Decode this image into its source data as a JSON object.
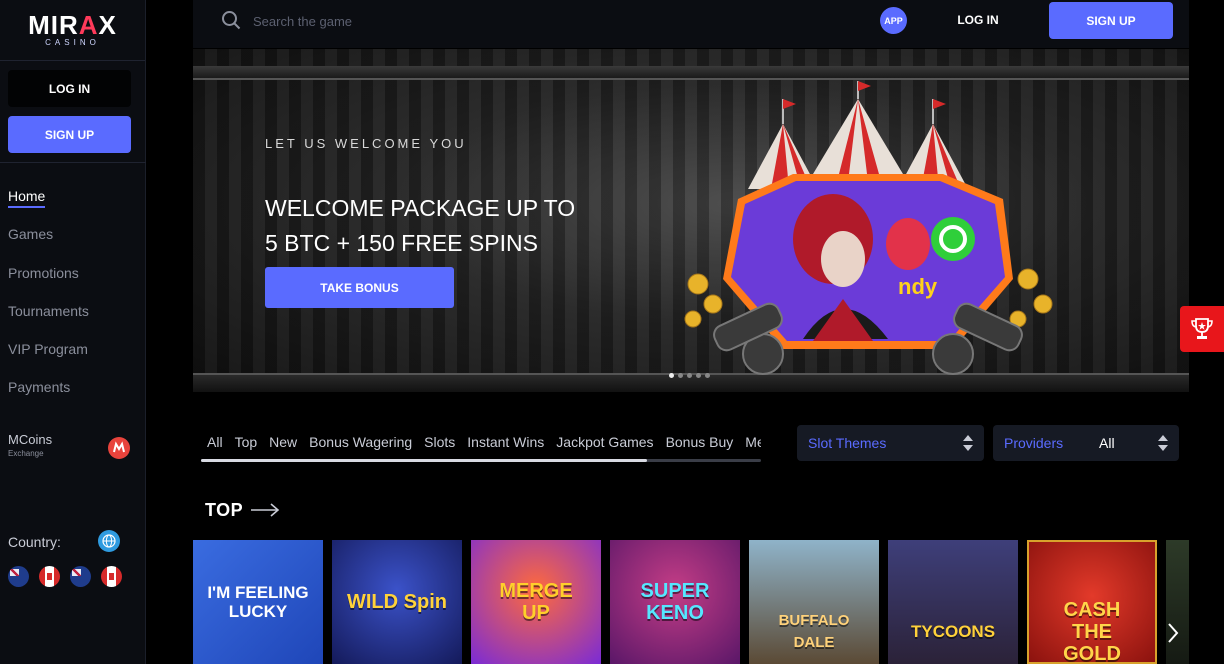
{
  "sidebar": {
    "logo": {
      "brand_a": "MIR",
      "brand_b": "A",
      "brand_c": "X",
      "sub": "CASINO"
    },
    "login_label": "LOG IN",
    "signup_label": "SIGN UP",
    "nav": [
      {
        "label": "Home",
        "active": true
      },
      {
        "label": "Games"
      },
      {
        "label": "Promotions"
      },
      {
        "label": "Tournaments"
      },
      {
        "label": "VIP Program"
      },
      {
        "label": "Payments"
      }
    ],
    "mcoins": {
      "title": "MCoins",
      "subtitle": "Exchange"
    },
    "country_label": "Country:",
    "flags": [
      "au",
      "ca",
      "au",
      "ca"
    ]
  },
  "topbar": {
    "search_placeholder": "Search the game",
    "app_label": "APP",
    "login_label": "LOG IN",
    "signup_label": "SIGN UP"
  },
  "banner": {
    "eyebrow": "LET US WELCOME YOU",
    "headline_line1": "WELCOME PACKAGE UP TO",
    "headline_line2": "5 BTC + 150 FREE SPINS",
    "cta_label": "TAKE BONUS",
    "slides_total": 5,
    "slide_active": 1
  },
  "filters": {
    "tabs": [
      "All",
      "Top",
      "New",
      "Bonus Wagering",
      "Slots",
      "Instant Wins",
      "Jackpot Games",
      "Bonus Buy",
      "Me"
    ],
    "slot_themes_label": "Slot Themes",
    "providers_label": "Providers",
    "providers_value": "All"
  },
  "top_section": {
    "title": "TOP",
    "games": [
      "I'M FEELING LUCKY",
      "WILD Spin",
      "MERGE UP",
      "SUPER KENO",
      "BUFFALO DALE",
      "TYCOONS",
      "CASH THE GOLD"
    ]
  },
  "colors": {
    "accent": "#5a6bff",
    "sidebar_bg": "#0b0d12",
    "trophy_bg": "#e8161b"
  }
}
